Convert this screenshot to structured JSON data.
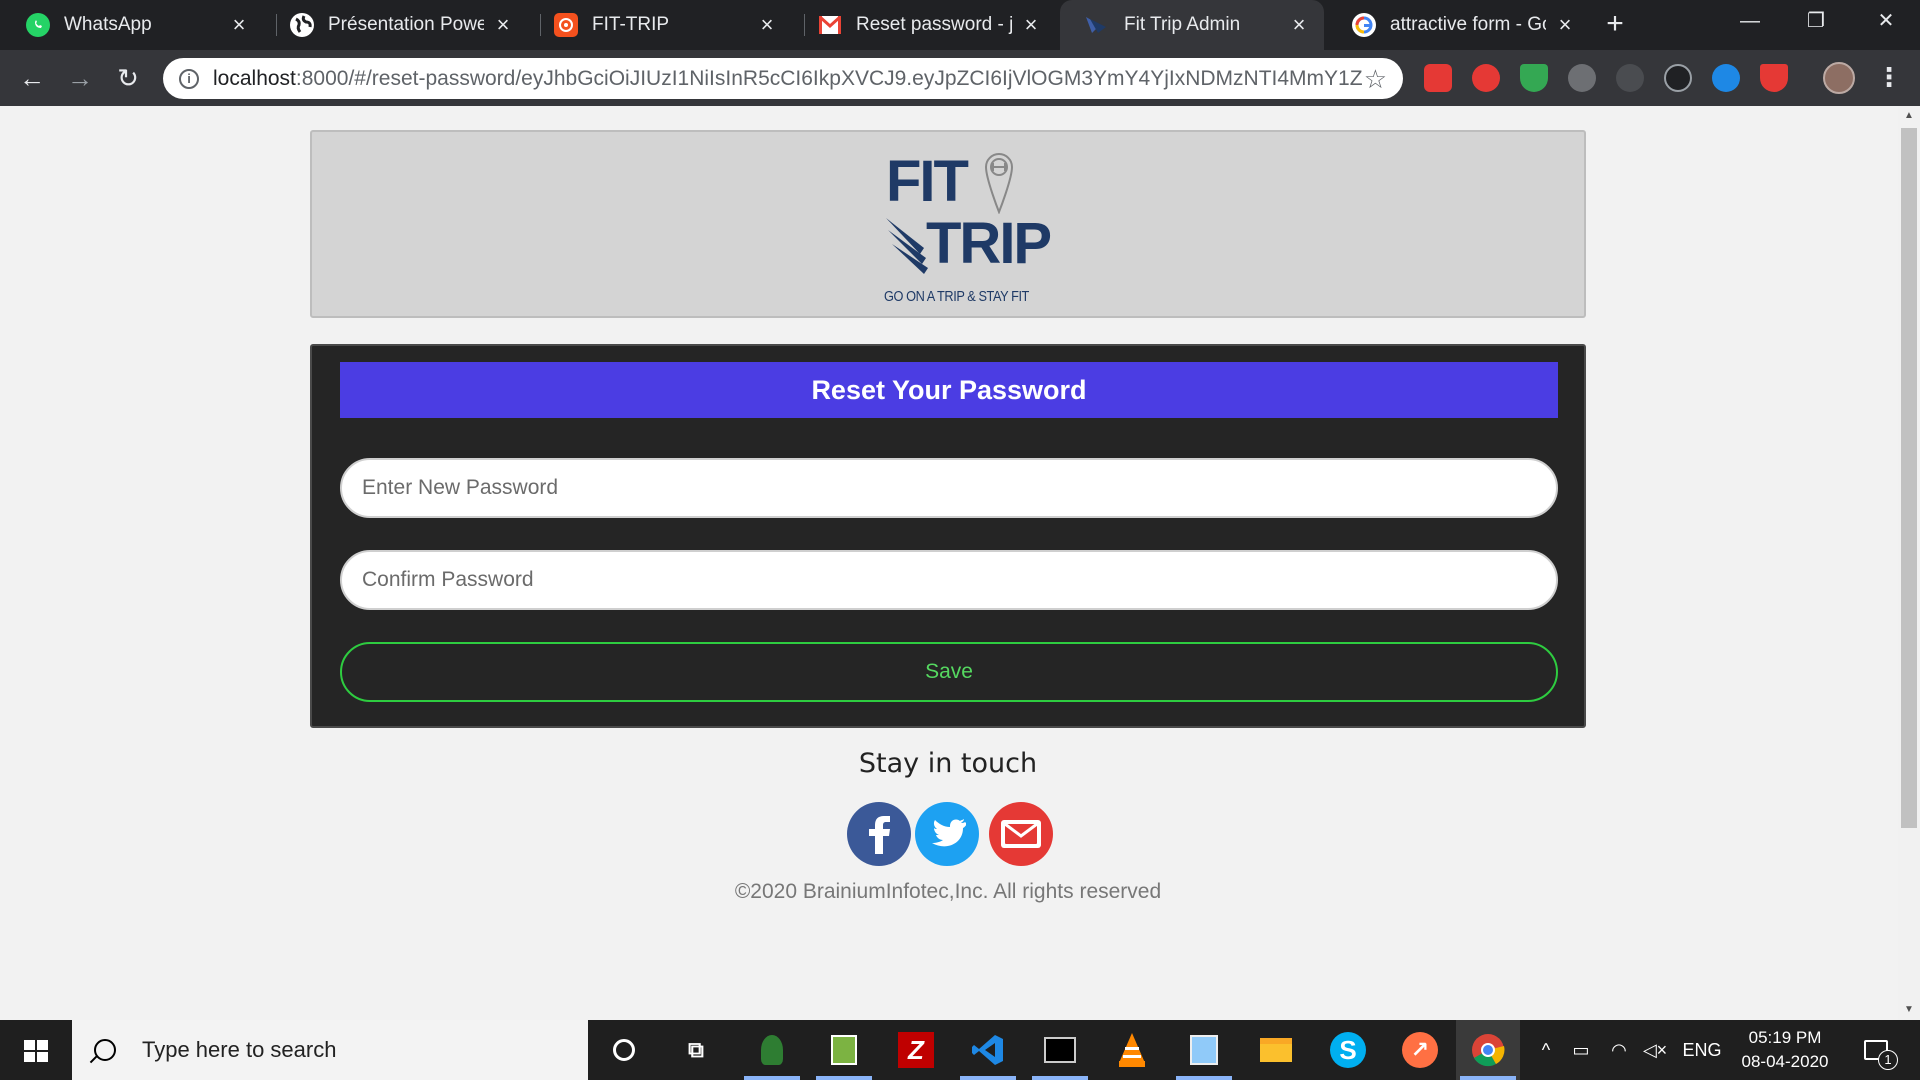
{
  "browser": {
    "tabs": [
      {
        "label": "WhatsApp",
        "icon": "whatsapp-icon",
        "color": "#25d366"
      },
      {
        "label": "Présentation PowerP",
        "icon": "globe-icon",
        "color": "#ffffff"
      },
      {
        "label": "FIT-TRIP",
        "icon": "fittrip-app-icon",
        "color": "#f4511e"
      },
      {
        "label": "Reset password - jay",
        "icon": "gmail-icon",
        "color": "#ea4335"
      },
      {
        "label": "Fit Trip Admin",
        "icon": "fittrip-wing-icon",
        "color": "#1f3a66",
        "active": true
      },
      {
        "label": "attractive form - Goo",
        "icon": "google-icon",
        "color": "#4285f4"
      }
    ],
    "url_host": "localhost",
    "url_rest": ":8000/#/reset-password/eyJhbGciOiJIUzI1NiIsInR5cCI6IkpXVCJ9.eyJpZCI6IjVlOGM3YmY4YjIxNDMzNTI4MmY1Z..."
  },
  "logo": {
    "word1": "FIT",
    "word2": "TRIP",
    "tagline": "GO ON A TRIP & STAY FIT"
  },
  "form": {
    "title": "Reset Your Password",
    "new_password_placeholder": "Enter New Password",
    "new_password_value": "",
    "confirm_password_placeholder": "Confirm Password",
    "confirm_password_value": "",
    "save_label": "Save"
  },
  "footer": {
    "stay_in_touch": "Stay in touch",
    "copyright": "©2020 BrainiumInfotec,Inc. All rights reserved",
    "social": [
      {
        "name": "facebook-icon",
        "color": "#3b5998"
      },
      {
        "name": "twitter-icon",
        "color": "#1da1f2"
      },
      {
        "name": "mail-icon",
        "color": "#e53935"
      }
    ]
  },
  "taskbar": {
    "search_placeholder": "Type here to search",
    "language": "ENG",
    "time": "05:19 PM",
    "date": "08-04-2020",
    "notification_count": "1"
  },
  "colors": {
    "header_accent": "#4b3de3",
    "save_border": "#2ecc40",
    "card_bg": "#252525"
  }
}
